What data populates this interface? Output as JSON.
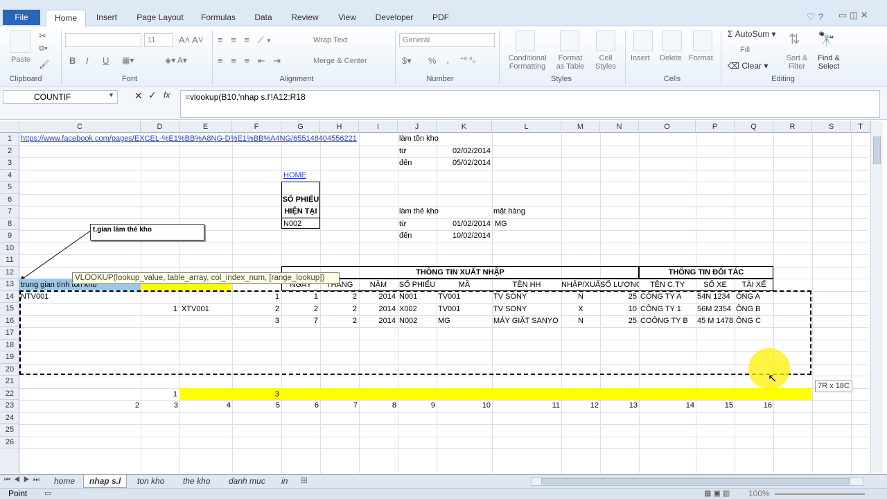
{
  "ribbon": {
    "tabs": [
      "File",
      "Home",
      "Insert",
      "Page Layout",
      "Formulas",
      "Data",
      "Review",
      "View",
      "Developer",
      "PDF"
    ],
    "clipboard": {
      "paste": "Paste",
      "label": "Clipboard"
    },
    "font": {
      "size": "11",
      "label": "Font",
      "bold": "B",
      "italic": "I",
      "underline": "U"
    },
    "alignment": {
      "wrap": "Wrap Text",
      "merge": "Merge & Center",
      "label": "Alignment"
    },
    "number": {
      "format": "General",
      "label": "Number",
      "percent": "%",
      "comma": ","
    },
    "styles": {
      "conditional1": "Conditional",
      "conditional2": "Formatting",
      "format_table1": "Format",
      "format_table2": "as Table",
      "cell_styles1": "Cell",
      "cell_styles2": "Styles",
      "label": "Styles"
    },
    "cells": {
      "insert": "Insert",
      "delete": "Delete",
      "format": "Format",
      "label": "Cells"
    },
    "editing": {
      "autosum": "AutoSum",
      "fill": "Fill",
      "clear": "Clear",
      "sort1": "Sort &",
      "sort2": "Filter",
      "find1": "Find &",
      "find2": "Select",
      "label": "Editing"
    }
  },
  "formula_bar": {
    "name_box": "COUNTIF",
    "formula": "=vlookup(B10,'nhap s.l'!A12:R18",
    "fx": "fx"
  },
  "tooltip": {
    "text": "VLOOKUP(lookup_value, table_array, col_index_num, [range_lookup])"
  },
  "columns": [
    "C",
    "D",
    "E",
    "F",
    "G",
    "H",
    "I",
    "J",
    "K",
    "L",
    "M",
    "N",
    "O",
    "P",
    "Q",
    "R",
    "S",
    "T"
  ],
  "rows": [
    "1",
    "2",
    "3",
    "4",
    "5",
    "6",
    "7",
    "8",
    "9",
    "10",
    "11",
    "12",
    "13",
    "14",
    "15",
    "16",
    "17",
    "18",
    "19",
    "20",
    "21",
    "22",
    "23",
    "24",
    "25",
    "26"
  ],
  "cells": {
    "link": "https://www.facebook.com/pages/EXCEL-%E1%BB%A8NG-D%E1%BB%A4NG/655148404556221",
    "lam_ton_kho": "làm tồn kho",
    "tu": "từ",
    "den": "đến",
    "date_from1": "02/02/2014",
    "date_to1": "05/02/2014",
    "home_link": "HOME",
    "so_phieu_hien_tai1": "SỐ PHIẾU",
    "so_phieu_hien_tai2": "HIỆN TẠI",
    "so_phieu_value": "N002",
    "lam_the_kho": "làm thẻ kho",
    "mat_hang": "mặt hàng",
    "tu2": "từ",
    "den2": "đến",
    "date_from2": "01/02/2014",
    "date_to2": "10/02/2014",
    "mat_hang_value": "MG",
    "note_box": "t.gian làm thẻ kho",
    "section1": "THÔNG TIN XUẤT NHẬP",
    "section2": "THÔNG TIN ĐỐI TÁC",
    "a11": "trung gian tính tồn kho",
    "headers": [
      "NGÀY",
      "THÁNG",
      "NĂM",
      "SỐ PHIẾU",
      "MÃ",
      "TÊN HH",
      "NHẬP/XUẤT",
      "SỐ LƯỢNG",
      "TÊN C.TY",
      "SỐ XE",
      "TÀI XẾ"
    ],
    "row12": {
      "a": "NTV001",
      "f": "1",
      "g": "1",
      "h": "2",
      "i": "2014",
      "j": "N001",
      "k": "TV001",
      "l": "TV SONY",
      "m": "N",
      "n": "25",
      "o": "CÔNG TY A",
      "p": "54N 1234",
      "q": "ÔNG A"
    },
    "row13": {
      "d": "1",
      "e": "XTV001",
      "f": "2",
      "g": "2",
      "h": "2",
      "i": "2014",
      "j": "X002",
      "k": "TV001",
      "l": "TV SONY",
      "m": "X",
      "n": "10",
      "o": "CÔNG TY 1",
      "p": "56M 2354",
      "q": "ÔNG B"
    },
    "row14": {
      "f": "3",
      "g": "7",
      "h": "2",
      "i": "2014",
      "j": "N002",
      "k": "MG",
      "l": "MÁY GIẶT SANYO",
      "m": "N",
      "n": "25",
      "o": "COÔNG TY B",
      "p": "45 M 1478",
      "q": "ÔNG C"
    },
    "row20": {
      "d": "1",
      "f": "3"
    },
    "row23": [
      "2",
      "3",
      "4",
      "5",
      "6",
      "7",
      "8",
      "9",
      "10",
      "11",
      "12",
      "13",
      "14",
      "15",
      "16"
    ],
    "selection_size": "7R x 18C"
  },
  "sheet_tabs": [
    "home",
    "nhap s.l",
    "ton kho",
    "the kho",
    "danh muc",
    "in"
  ],
  "status": {
    "mode": "Point",
    "zoom": "100%"
  },
  "colors": {
    "accent": "#2a66b7",
    "highlight": "#ffff00",
    "header_fill": "#9ec6e6"
  }
}
